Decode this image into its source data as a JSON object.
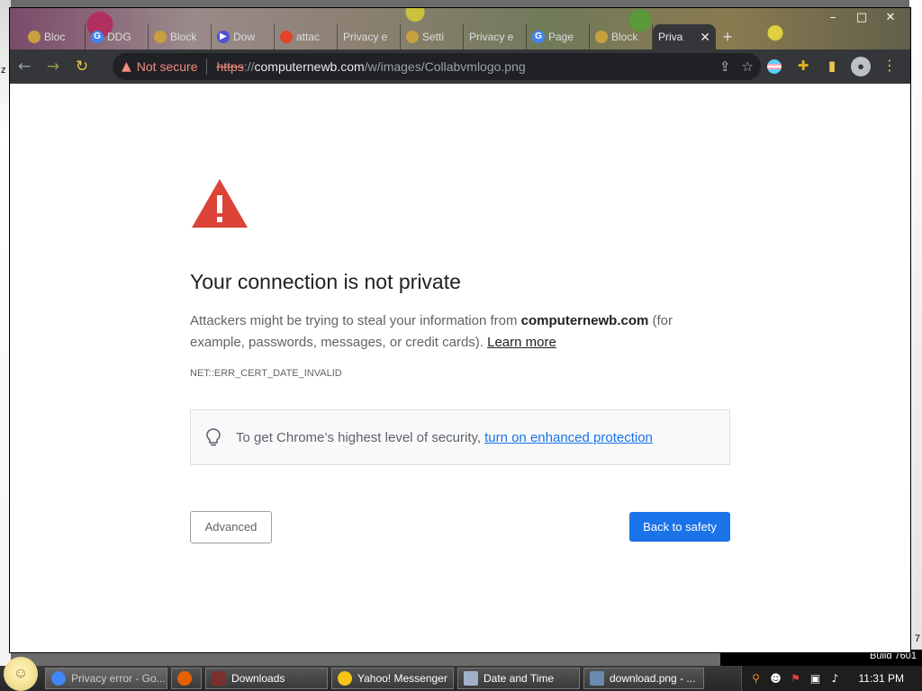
{
  "desktop": {
    "left_glyph": "z",
    "build_number_tail": "7",
    "build_text": "Build 7601"
  },
  "browser": {
    "window_controls": {
      "minimize": "–",
      "maximize": "□",
      "close": "✕"
    },
    "tabs": [
      {
        "label": "Bloc",
        "icon": "blocked-site-icon",
        "color": "#c8a040"
      },
      {
        "label": "DDG",
        "icon": "google-icon",
        "color": "#4285f4"
      },
      {
        "label": "Block",
        "icon": "blocked-site-icon",
        "color": "#c8a040"
      },
      {
        "label": "Dow",
        "icon": "download-play-icon",
        "color": "#5050d0"
      },
      {
        "label": "attac",
        "icon": "gitlab-icon",
        "color": "#e24329"
      },
      {
        "label": "Privacy e",
        "icon": "none",
        "color": ""
      },
      {
        "label": "Setti",
        "icon": "settings-icon",
        "color": "#c8a040"
      },
      {
        "label": "Privacy e",
        "icon": "none",
        "color": ""
      },
      {
        "label": "Page",
        "icon": "google-icon",
        "color": "#4285f4"
      },
      {
        "label": "Block",
        "icon": "blocked-site-icon",
        "color": "#c8a040"
      }
    ],
    "active_tab": {
      "label": "Priva",
      "close": "✕"
    },
    "new_tab": "+",
    "toolbar": {
      "back": "←",
      "forward": "→",
      "reload": "↻",
      "security_label": "Not secure",
      "url_scheme": "https",
      "url_slashes": "://",
      "url_host": "computernewb.com",
      "url_path": "/w/images/Collabvmlogo.png",
      "share_icon": "⇪",
      "star_icon": "☆",
      "menu_icon": "⋮"
    },
    "colors": {
      "accent_blue": "#1a73e8",
      "warning_red": "#db4437",
      "not_secure_red": "#f28b82",
      "toolbar_bg": "#35363a"
    }
  },
  "interstitial": {
    "heading": "Your connection is not private",
    "desc_before": "Attackers might be trying to steal your information from ",
    "desc_host": "computernewb.com",
    "desc_after": " (for example, passwords, messages, or credit cards). ",
    "learn_more": "Learn more",
    "error_code": "NET::ERR_CERT_DATE_INVALID",
    "enhanced_text": "To get Chrome’s highest level of security,",
    "enhanced_link": "turn on enhanced protection",
    "advanced_button": "Advanced",
    "back_button": "Back to safety"
  },
  "taskbar": {
    "tasks": [
      {
        "label": "Privacy error - Go...",
        "icon": "chrome-icon",
        "active": true
      },
      {
        "label": "",
        "icon": "firefox-icon",
        "active": false
      },
      {
        "label": "Downloads",
        "icon": "downloads-folder-icon",
        "active": false
      },
      {
        "label": "Yahoo! Messenger",
        "icon": "yahoo-messenger-icon",
        "active": false
      },
      {
        "label": "Date and Time",
        "icon": "date-time-icon",
        "active": false
      },
      {
        "label": "download.png - ...",
        "icon": "image-viewer-icon",
        "active": false
      }
    ],
    "clock": "11:31 PM"
  }
}
